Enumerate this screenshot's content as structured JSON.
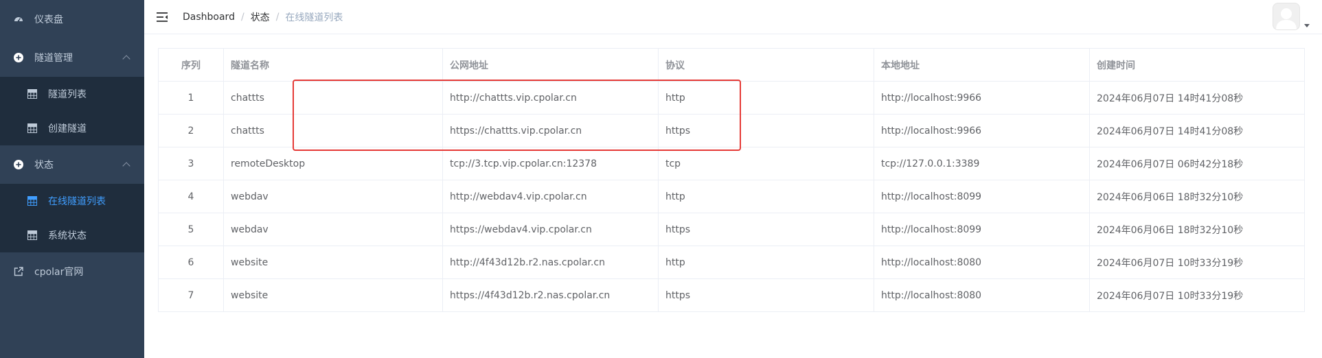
{
  "sidebar": {
    "dashboard": "仪表盘",
    "tunnel_mgmt": "隧道管理",
    "tunnel_list": "隧道列表",
    "create_tunnel": "创建隧道",
    "status": "状态",
    "online_list": "在线隧道列表",
    "system_status": "系统状态",
    "official_site": "cpolar官网"
  },
  "breadcrumb": {
    "root": "Dashboard",
    "level2": "状态",
    "current": "在线隧道列表",
    "separator": "/"
  },
  "table": {
    "headers": [
      "序列",
      "隧道名称",
      "公网地址",
      "协议",
      "本地地址",
      "创建时间"
    ],
    "rows": [
      [
        "1",
        "chattts",
        "http://chattts.vip.cpolar.cn",
        "http",
        "http://localhost:9966",
        "2024年06月07日 14时41分08秒"
      ],
      [
        "2",
        "chattts",
        "https://chattts.vip.cpolar.cn",
        "https",
        "http://localhost:9966",
        "2024年06月07日 14时41分08秒"
      ],
      [
        "3",
        "remoteDesktop",
        "tcp://3.tcp.vip.cpolar.cn:12378",
        "tcp",
        "tcp://127.0.0.1:3389",
        "2024年06月07日 06时42分18秒"
      ],
      [
        "4",
        "webdav",
        "http://webdav4.vip.cpolar.cn",
        "http",
        "http://localhost:8099",
        "2024年06月06日 18时32分10秒"
      ],
      [
        "5",
        "webdav",
        "https://webdav4.vip.cpolar.cn",
        "https",
        "http://localhost:8099",
        "2024年06月06日 18时32分10秒"
      ],
      [
        "6",
        "website",
        "http://4f43d12b.r2.nas.cpolar.cn",
        "http",
        "http://localhost:8080",
        "2024年06月07日 10时33分19秒"
      ],
      [
        "7",
        "website",
        "https://4f43d12b.r2.nas.cpolar.cn",
        "https",
        "http://localhost:8080",
        "2024年06月07日 10时33分19秒"
      ]
    ]
  },
  "colors": {
    "sidebar_bg": "#304156",
    "submenu_bg": "#1f2d3d",
    "active": "#409eff",
    "highlight": "#e53935"
  }
}
